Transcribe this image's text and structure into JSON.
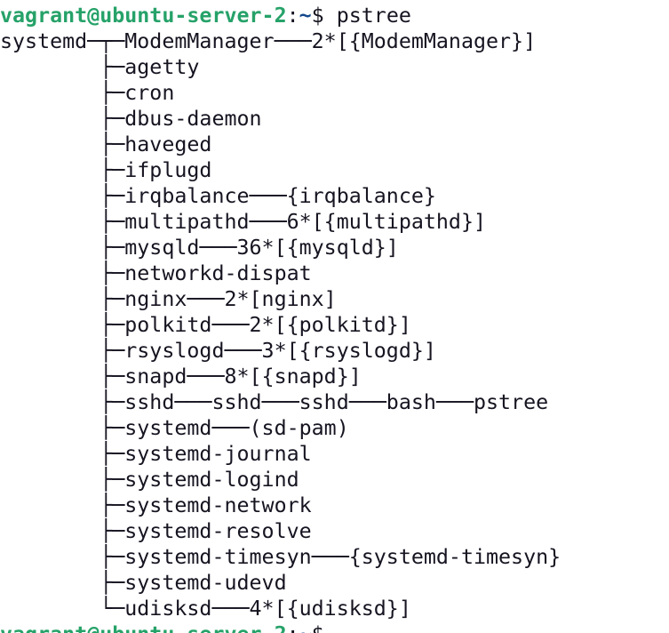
{
  "prompt": {
    "user_host": "vagrant@ubuntu-server-2",
    "separator": ":",
    "path": "~",
    "symbol": "$ "
  },
  "command": "pstree",
  "output_lines": [
    "systemd─┬─ModemManager───2*[{ModemManager}]",
    "        ├─agetty",
    "        ├─cron",
    "        ├─dbus-daemon",
    "        ├─haveged",
    "        ├─ifplugd",
    "        ├─irqbalance───{irqbalance}",
    "        ├─multipathd───6*[{multipathd}]",
    "        ├─mysqld───36*[{mysqld}]",
    "        ├─networkd-dispat",
    "        ├─nginx───2*[nginx]",
    "        ├─polkitd───2*[{polkitd}]",
    "        ├─rsyslogd───3*[{rsyslogd}]",
    "        ├─snapd───8*[{snapd}]",
    "        ├─sshd───sshd───sshd───bash───pstree",
    "        ├─systemd───(sd-pam)",
    "        ├─systemd-journal",
    "        ├─systemd-logind",
    "        ├─systemd-network",
    "        ├─systemd-resolve",
    "        ├─systemd-timesyn───{systemd-timesyn}",
    "        ├─systemd-udevd",
    "        └─udisksd───4*[{udisksd}]"
  ],
  "colors": {
    "background": "#ffffff",
    "text": "#171421",
    "user_host": "#26a269",
    "path": "#12488b"
  }
}
